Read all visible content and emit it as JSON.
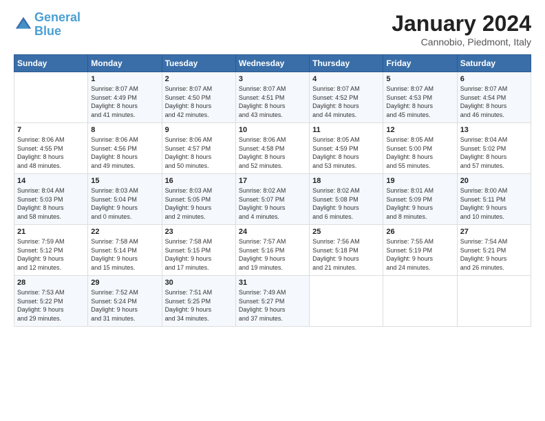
{
  "header": {
    "logo_line1": "General",
    "logo_line2": "Blue",
    "month": "January 2024",
    "location": "Cannobio, Piedmont, Italy"
  },
  "days_of_week": [
    "Sunday",
    "Monday",
    "Tuesday",
    "Wednesday",
    "Thursday",
    "Friday",
    "Saturday"
  ],
  "weeks": [
    [
      {
        "day": "",
        "info": ""
      },
      {
        "day": "1",
        "info": "Sunrise: 8:07 AM\nSunset: 4:49 PM\nDaylight: 8 hours\nand 41 minutes."
      },
      {
        "day": "2",
        "info": "Sunrise: 8:07 AM\nSunset: 4:50 PM\nDaylight: 8 hours\nand 42 minutes."
      },
      {
        "day": "3",
        "info": "Sunrise: 8:07 AM\nSunset: 4:51 PM\nDaylight: 8 hours\nand 43 minutes."
      },
      {
        "day": "4",
        "info": "Sunrise: 8:07 AM\nSunset: 4:52 PM\nDaylight: 8 hours\nand 44 minutes."
      },
      {
        "day": "5",
        "info": "Sunrise: 8:07 AM\nSunset: 4:53 PM\nDaylight: 8 hours\nand 45 minutes."
      },
      {
        "day": "6",
        "info": "Sunrise: 8:07 AM\nSunset: 4:54 PM\nDaylight: 8 hours\nand 46 minutes."
      }
    ],
    [
      {
        "day": "7",
        "info": "Sunrise: 8:06 AM\nSunset: 4:55 PM\nDaylight: 8 hours\nand 48 minutes."
      },
      {
        "day": "8",
        "info": "Sunrise: 8:06 AM\nSunset: 4:56 PM\nDaylight: 8 hours\nand 49 minutes."
      },
      {
        "day": "9",
        "info": "Sunrise: 8:06 AM\nSunset: 4:57 PM\nDaylight: 8 hours\nand 50 minutes."
      },
      {
        "day": "10",
        "info": "Sunrise: 8:06 AM\nSunset: 4:58 PM\nDaylight: 8 hours\nand 52 minutes."
      },
      {
        "day": "11",
        "info": "Sunrise: 8:05 AM\nSunset: 4:59 PM\nDaylight: 8 hours\nand 53 minutes."
      },
      {
        "day": "12",
        "info": "Sunrise: 8:05 AM\nSunset: 5:00 PM\nDaylight: 8 hours\nand 55 minutes."
      },
      {
        "day": "13",
        "info": "Sunrise: 8:04 AM\nSunset: 5:02 PM\nDaylight: 8 hours\nand 57 minutes."
      }
    ],
    [
      {
        "day": "14",
        "info": "Sunrise: 8:04 AM\nSunset: 5:03 PM\nDaylight: 8 hours\nand 58 minutes."
      },
      {
        "day": "15",
        "info": "Sunrise: 8:03 AM\nSunset: 5:04 PM\nDaylight: 9 hours\nand 0 minutes."
      },
      {
        "day": "16",
        "info": "Sunrise: 8:03 AM\nSunset: 5:05 PM\nDaylight: 9 hours\nand 2 minutes."
      },
      {
        "day": "17",
        "info": "Sunrise: 8:02 AM\nSunset: 5:07 PM\nDaylight: 9 hours\nand 4 minutes."
      },
      {
        "day": "18",
        "info": "Sunrise: 8:02 AM\nSunset: 5:08 PM\nDaylight: 9 hours\nand 6 minutes."
      },
      {
        "day": "19",
        "info": "Sunrise: 8:01 AM\nSunset: 5:09 PM\nDaylight: 9 hours\nand 8 minutes."
      },
      {
        "day": "20",
        "info": "Sunrise: 8:00 AM\nSunset: 5:11 PM\nDaylight: 9 hours\nand 10 minutes."
      }
    ],
    [
      {
        "day": "21",
        "info": "Sunrise: 7:59 AM\nSunset: 5:12 PM\nDaylight: 9 hours\nand 12 minutes."
      },
      {
        "day": "22",
        "info": "Sunrise: 7:58 AM\nSunset: 5:14 PM\nDaylight: 9 hours\nand 15 minutes."
      },
      {
        "day": "23",
        "info": "Sunrise: 7:58 AM\nSunset: 5:15 PM\nDaylight: 9 hours\nand 17 minutes."
      },
      {
        "day": "24",
        "info": "Sunrise: 7:57 AM\nSunset: 5:16 PM\nDaylight: 9 hours\nand 19 minutes."
      },
      {
        "day": "25",
        "info": "Sunrise: 7:56 AM\nSunset: 5:18 PM\nDaylight: 9 hours\nand 21 minutes."
      },
      {
        "day": "26",
        "info": "Sunrise: 7:55 AM\nSunset: 5:19 PM\nDaylight: 9 hours\nand 24 minutes."
      },
      {
        "day": "27",
        "info": "Sunrise: 7:54 AM\nSunset: 5:21 PM\nDaylight: 9 hours\nand 26 minutes."
      }
    ],
    [
      {
        "day": "28",
        "info": "Sunrise: 7:53 AM\nSunset: 5:22 PM\nDaylight: 9 hours\nand 29 minutes."
      },
      {
        "day": "29",
        "info": "Sunrise: 7:52 AM\nSunset: 5:24 PM\nDaylight: 9 hours\nand 31 minutes."
      },
      {
        "day": "30",
        "info": "Sunrise: 7:51 AM\nSunset: 5:25 PM\nDaylight: 9 hours\nand 34 minutes."
      },
      {
        "day": "31",
        "info": "Sunrise: 7:49 AM\nSunset: 5:27 PM\nDaylight: 9 hours\nand 37 minutes."
      },
      {
        "day": "",
        "info": ""
      },
      {
        "day": "",
        "info": ""
      },
      {
        "day": "",
        "info": ""
      }
    ]
  ]
}
